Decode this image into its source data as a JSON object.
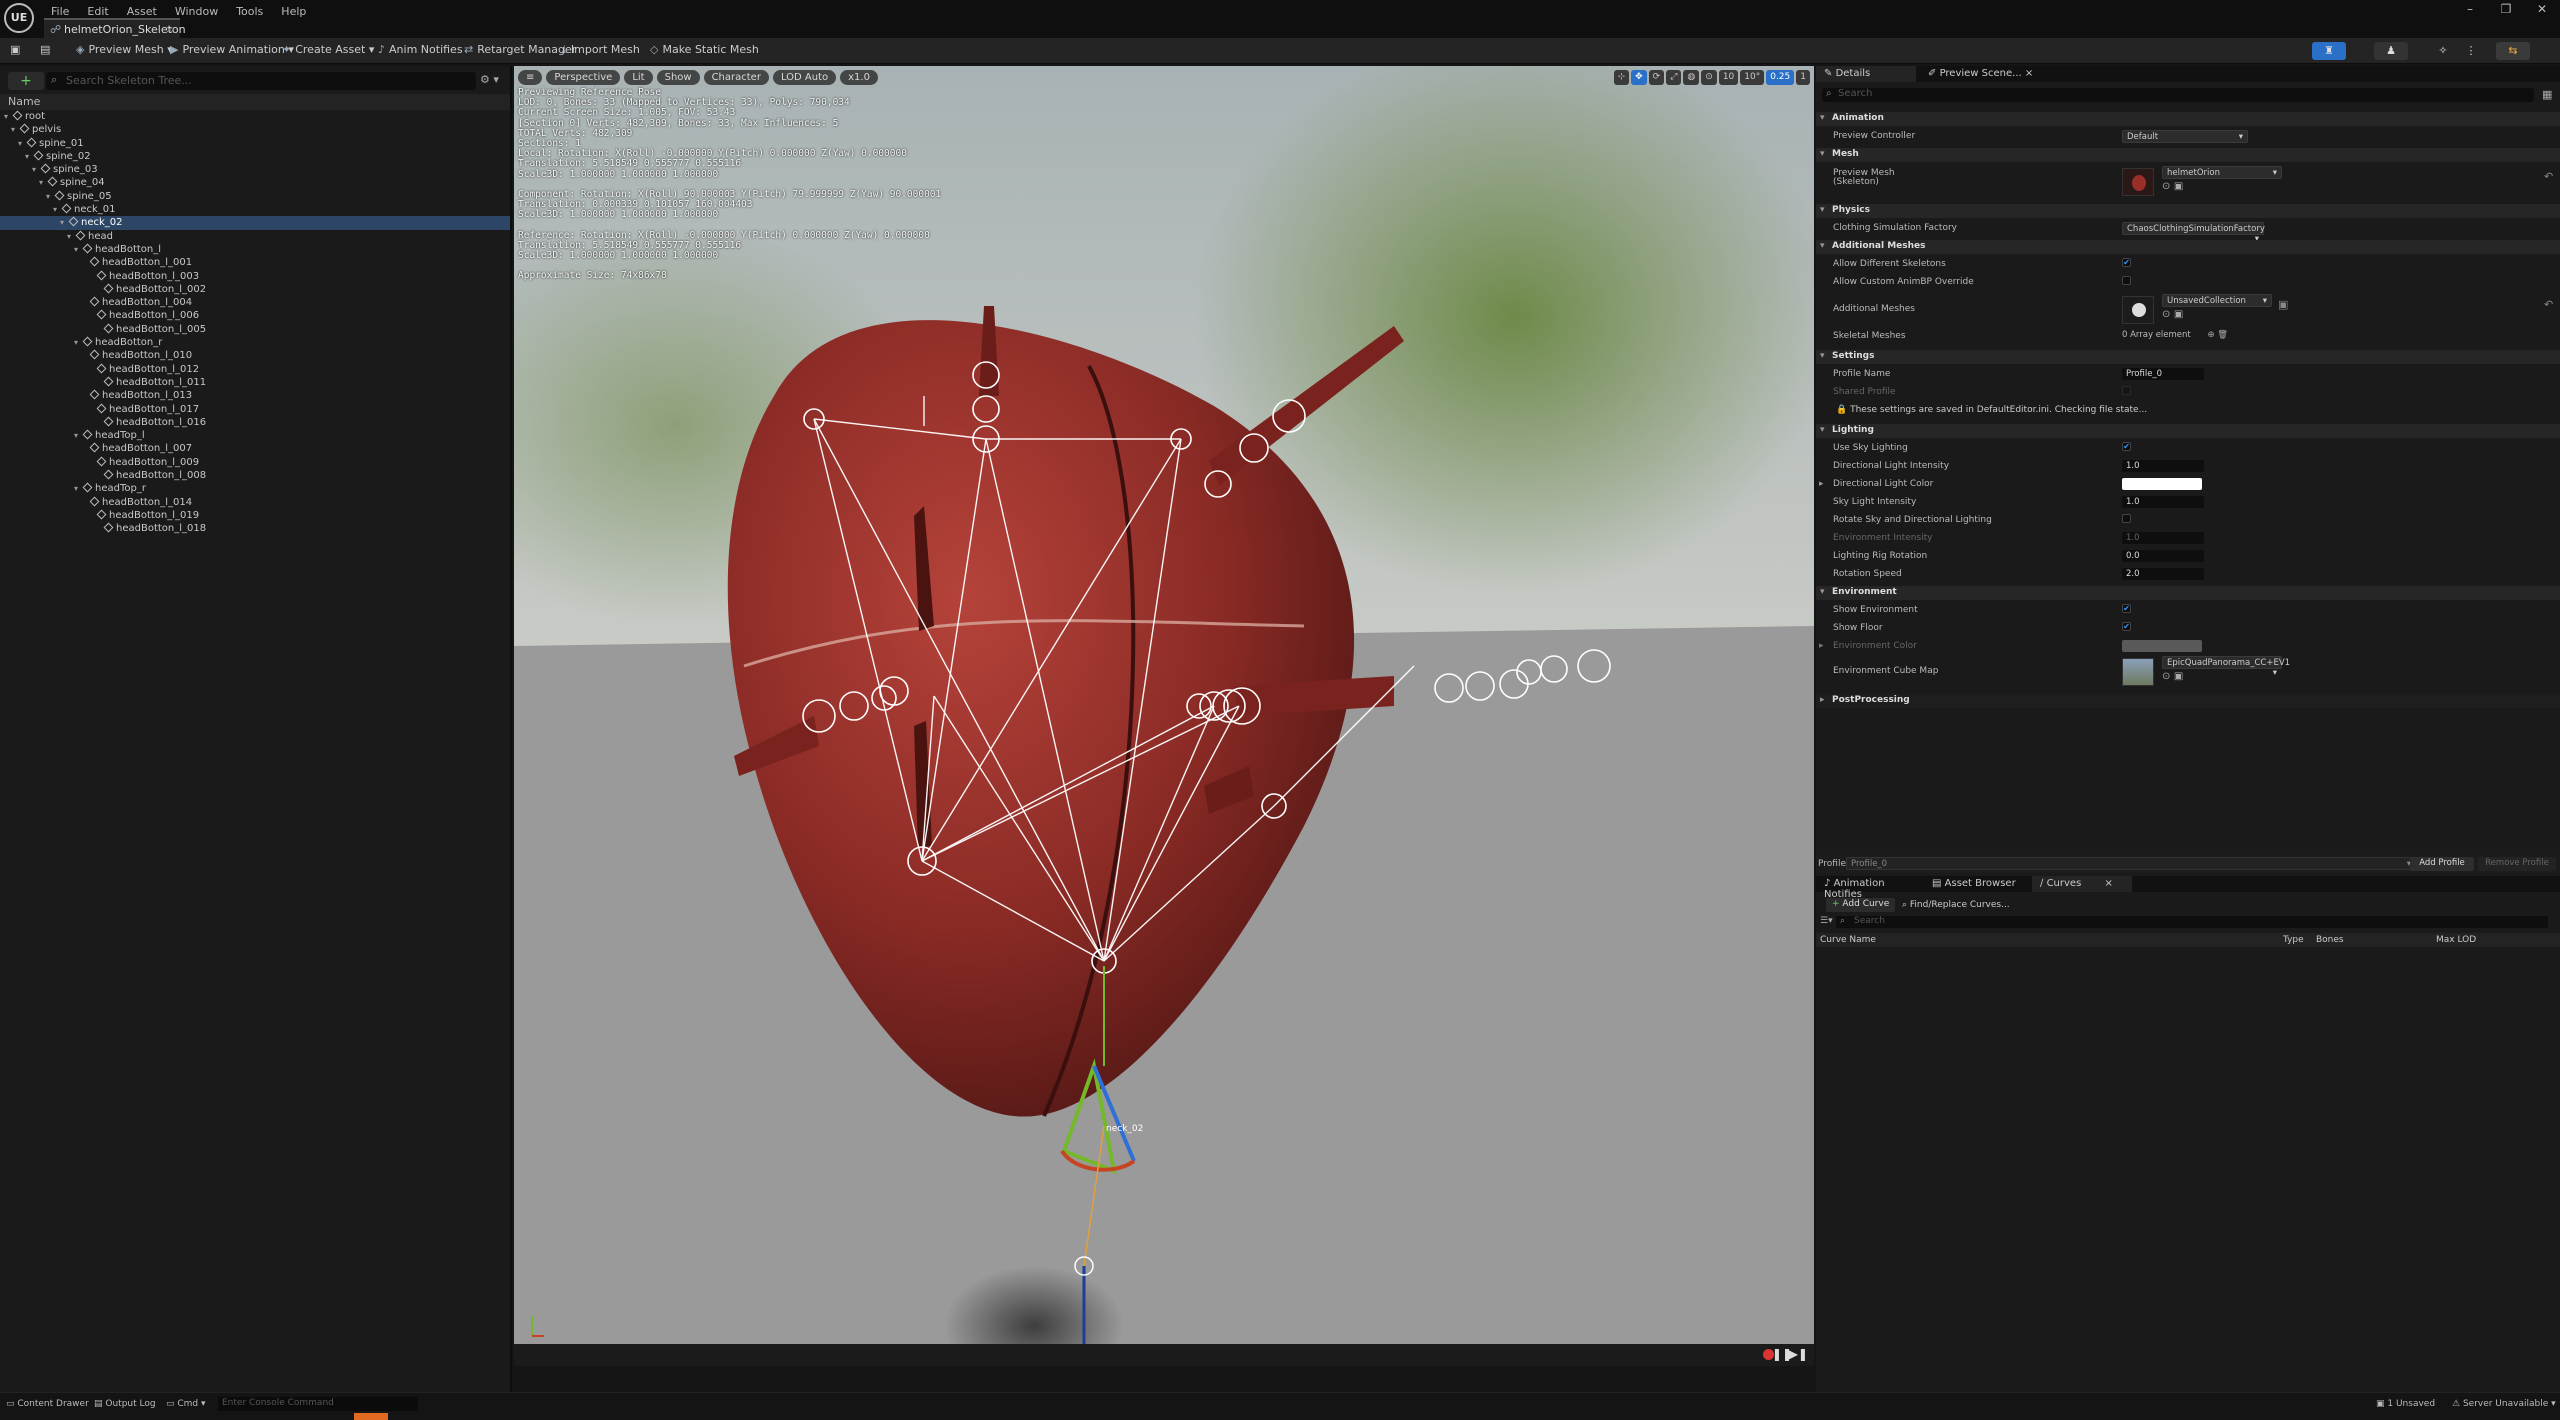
{
  "app": {
    "logo": "UE",
    "tab_title": "helmetOrion_Skeleton"
  },
  "menu": [
    "File",
    "Edit",
    "Asset",
    "Window",
    "Tools",
    "Help"
  ],
  "toolbar": {
    "preview_mesh": "Preview Mesh",
    "preview_animation": "Preview Animation",
    "create_asset": "Create Asset",
    "anim_notifies": "Anim Notifies",
    "retarget_manager": "Retarget Manager",
    "import_mesh": "Import Mesh",
    "make_static_mesh": "Make Static Mesh"
  },
  "skeleton_tree": {
    "search_placeholder": "Search Skeleton Tree...",
    "column_name": "Name",
    "bones": [
      {
        "name": "root",
        "depth": 0
      },
      {
        "name": "pelvis",
        "depth": 1
      },
      {
        "name": "spine_01",
        "depth": 2
      },
      {
        "name": "spine_02",
        "depth": 3
      },
      {
        "name": "spine_03",
        "depth": 4
      },
      {
        "name": "spine_04",
        "depth": 5
      },
      {
        "name": "spine_05",
        "depth": 6
      },
      {
        "name": "neck_01",
        "depth": 7
      },
      {
        "name": "neck_02",
        "depth": 8,
        "selected": true
      },
      {
        "name": "head",
        "depth": 9
      },
      {
        "name": "headBotton_l",
        "depth": 10
      },
      {
        "name": "headBotton_l_001",
        "depth": 11
      },
      {
        "name": "headBotton_l_003",
        "depth": 12
      },
      {
        "name": "headBotton_l_002",
        "depth": 13
      },
      {
        "name": "headBotton_l_004",
        "depth": 11
      },
      {
        "name": "headBotton_l_006",
        "depth": 12
      },
      {
        "name": "headBotton_l_005",
        "depth": 13
      },
      {
        "name": "headBotton_r",
        "depth": 10
      },
      {
        "name": "headBotton_l_010",
        "depth": 11
      },
      {
        "name": "headBotton_l_012",
        "depth": 12
      },
      {
        "name": "headBotton_l_011",
        "depth": 13
      },
      {
        "name": "headBotton_l_013",
        "depth": 11
      },
      {
        "name": "headBotton_l_017",
        "depth": 12
      },
      {
        "name": "headBotton_l_016",
        "depth": 13
      },
      {
        "name": "headTop_l",
        "depth": 10
      },
      {
        "name": "headBotton_l_007",
        "depth": 11
      },
      {
        "name": "headBotton_l_009",
        "depth": 12
      },
      {
        "name": "headBotton_l_008",
        "depth": 13
      },
      {
        "name": "headTop_r",
        "depth": 10
      },
      {
        "name": "headBotton_l_014",
        "depth": 11
      },
      {
        "name": "headBotton_l_019",
        "depth": 12
      },
      {
        "name": "headBotton_l_018",
        "depth": 13
      }
    ]
  },
  "viewport": {
    "buttons": [
      "Perspective",
      "Lit",
      "Show",
      "Character",
      "LOD Auto",
      "x1.0"
    ],
    "right_icons": [
      "10",
      "10°",
      "0.25",
      "1"
    ],
    "info_lines": [
      "Previewing Reference Pose",
      "LOD: 0, Bones: 33 (Mapped to Vertices: 33), Polys: 790,034",
      "Current Screen Size: 1.005, FOV: 53.43",
      "[Section 0] Verts: 482,309, Bones: 33, Max Influences: 5",
      "TOTAL Verts: 482,309",
      "Sections: 1",
      "Local: Rotation: X(Roll) -0.000000 Y(Pitch) 0.000000 Z(Yaw) 0.000000",
      "Translation: 5.518549 0.555777 0.555116",
      "Scale3D: 1.000000 1.000000 1.000000",
      "",
      "Component: Rotation: X(Roll) 90.000003 Y(Pitch) 79.999999 Z(Yaw) 90.000001",
      "Translation: 0.000339 0.101057 160.004403",
      "Scale3D: 1.000000 1.000000 1.000000",
      "",
      "Reference: Rotation: X(Roll) -0.000000 Y(Pitch) 0.000000 Z(Yaw) 0.000000",
      "Translation: 5.518549 0.555777 0.555116",
      "Scale3D: 1.000000 1.000000 1.000000",
      "",
      "Approximate Size: 74x86x78"
    ],
    "gizmo_label": "neck_02"
  },
  "details": {
    "tabs": [
      "Details",
      "Preview Scene..."
    ],
    "search_placeholder": "Search",
    "sections": {
      "animation": "Animation",
      "mesh": "Mesh",
      "physics": "Physics",
      "additional_meshes": "Additional Meshes",
      "settings": "Settings",
      "lighting": "Lighting",
      "environment": "Environment",
      "postprocessing": "PostProcessing"
    },
    "preview_controller": {
      "label": "Preview Controller",
      "value": "Default"
    },
    "preview_mesh": {
      "label": "Preview Mesh (Skeleton)",
      "value": "helmetOrion"
    },
    "clothing_factory": {
      "label": "Clothing Simulation Factory",
      "value": "ChaosClothingSimulationFactory"
    },
    "allow_different_skeletons": {
      "label": "Allow Different Skeletons",
      "checked": true
    },
    "allow_custom_animbp": {
      "label": "Allow Custom AnimBP Override",
      "checked": false
    },
    "additional_meshes": {
      "label": "Additional Meshes",
      "value": "UnsavedCollection"
    },
    "skeletal_meshes": {
      "label": "Skeletal Meshes",
      "value": "0 Array element"
    },
    "profile_name": {
      "label": "Profile Name",
      "value": "Profile_0"
    },
    "shared_profile": {
      "label": "Shared Profile"
    },
    "settings_note": "These settings are saved in DefaultEditor.ini. Checking file state...",
    "use_sky_lighting": {
      "label": "Use Sky Lighting",
      "checked": true
    },
    "directional_light_intensity": {
      "label": "Directional Light Intensity",
      "value": "1.0"
    },
    "directional_light_color": {
      "label": "Directional Light Color",
      "color": "#ffffff"
    },
    "sky_light_intensity": {
      "label": "Sky Light Intensity",
      "value": "1.0"
    },
    "rotate_sky": {
      "label": "Rotate Sky and Directional Lighting",
      "checked": false
    },
    "environment_intensity": {
      "label": "Environment Intensity",
      "value": "1.0"
    },
    "lighting_rig_rotation": {
      "label": "Lighting Rig Rotation",
      "value": "0.0"
    },
    "rotation_speed": {
      "label": "Rotation Speed",
      "value": "2.0"
    },
    "show_environment": {
      "label": "Show Environment",
      "checked": true
    },
    "show_floor": {
      "label": "Show Floor",
      "checked": true
    },
    "environment_color": {
      "label": "Environment Color",
      "color": "#595959"
    },
    "environment_cube_map": {
      "label": "Environment Cube Map",
      "value": "EpicQuadPanorama_CC+EV1"
    },
    "profile_bar": {
      "label": "Profile",
      "value": "Profile_0",
      "add": "Add Profile",
      "remove": "Remove Profile"
    }
  },
  "curves_panel": {
    "tabs": [
      "Animation Notifies",
      "Asset Browser",
      "Curves"
    ],
    "add_curve": "Add Curve",
    "find_replace": "Find/Replace Curves...",
    "search_placeholder": "Search",
    "columns": [
      "Curve Name",
      "Type",
      "Bones",
      "Max LOD"
    ]
  },
  "statusbar": {
    "content_drawer": "Content Drawer",
    "output_log": "Output Log",
    "cmd": "Cmd",
    "console_placeholder": "Enter Console Command",
    "unsaved": "1 Unsaved",
    "source_control": "Server Unavailable"
  },
  "colors": {
    "accent": "#2a70c8",
    "selection": "#2d4665",
    "mesh": "#8a2a25"
  }
}
